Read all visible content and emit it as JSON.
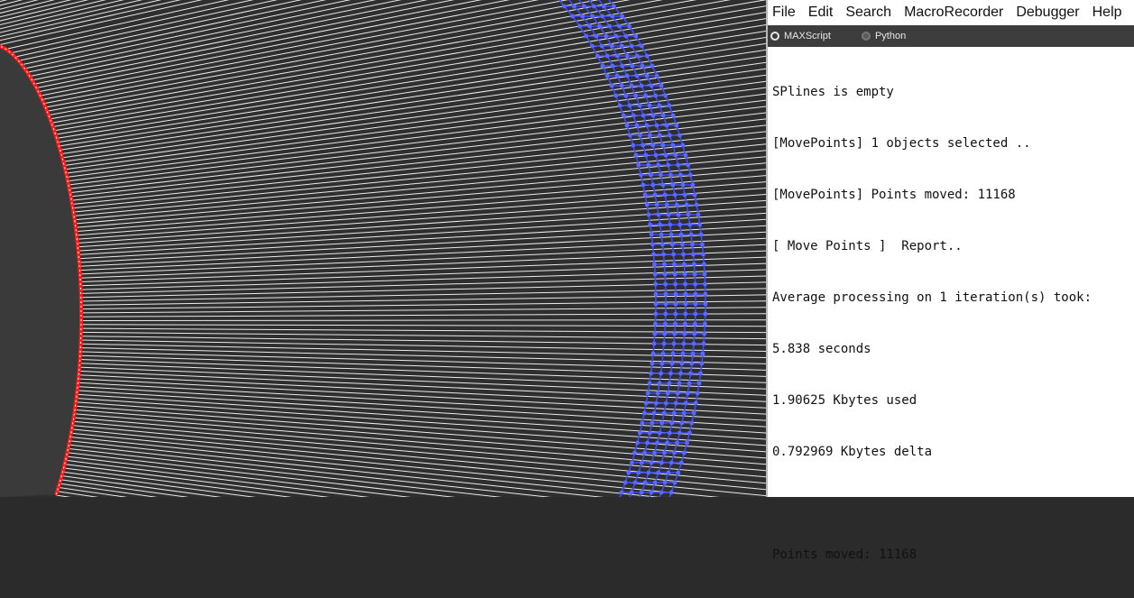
{
  "menu": {
    "items": [
      "File",
      "Edit",
      "Search",
      "MacroRecorder",
      "Debugger",
      "Help"
    ]
  },
  "toolbar": {
    "options": [
      {
        "label": "MAXScript",
        "selected": true
      },
      {
        "label": "Python",
        "selected": false
      }
    ]
  },
  "output": {
    "lines": [
      "SPlines is empty",
      "[MovePoints] 1 objects selected ..",
      "[MovePoints] Points moved: 11168",
      "[ Move Points ]  Report..",
      "Average processing on 1 iteration(s) took:",
      "5.838 seconds",
      "1.90625 Kbytes used",
      "0.792969 Kbytes delta",
      "",
      "Points moved: 11168"
    ]
  },
  "colors": {
    "viewport_bg": "#2f2f2f",
    "spline_lines": "#ffffff",
    "boundary_curve": "#ff1a1a",
    "vertex_points": "#3c4cff",
    "toolbar_bg": "#3d3d3d"
  }
}
